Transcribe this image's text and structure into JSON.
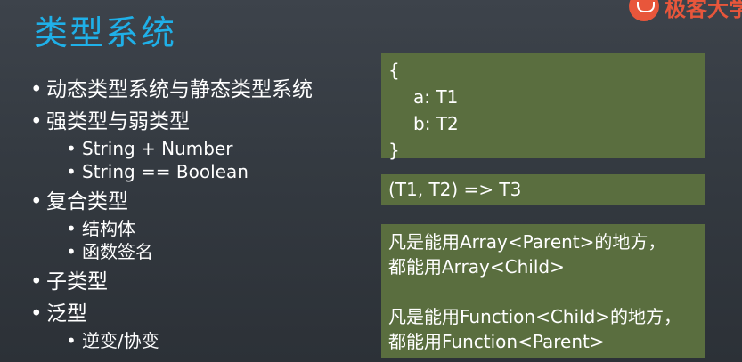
{
  "slide": {
    "title": "类型系统",
    "logo_text": "极客大学"
  },
  "outline": {
    "items": [
      {
        "label": "动态类型系统与静态类型系统",
        "children": []
      },
      {
        "label": "强类型与弱类型",
        "children": [
          "String + Number",
          "String == Boolean"
        ]
      },
      {
        "label": "复合类型",
        "children": [
          "结构体",
          "函数签名"
        ]
      },
      {
        "label": "子类型",
        "children": []
      },
      {
        "label": "泛型",
        "children": [
          "逆变/协变"
        ]
      }
    ]
  },
  "code_box": {
    "open": "{",
    "line1": "a: T1",
    "line2": "b: T2",
    "close": "}"
  },
  "fn_box": {
    "text": "(T1, T2) => T3"
  },
  "rule_box": {
    "rule1_line1": "凡是能用Array<Parent>的地方，",
    "rule1_line2": "都能用Array<Child>",
    "rule2_line1": "凡是能用Function<Child>的地方，",
    "rule2_line2": "都能用Function<Parent>"
  },
  "colors": {
    "title": "#1fb0e8",
    "box_bg": "#5a6e3f",
    "logo": "#e8563b"
  }
}
